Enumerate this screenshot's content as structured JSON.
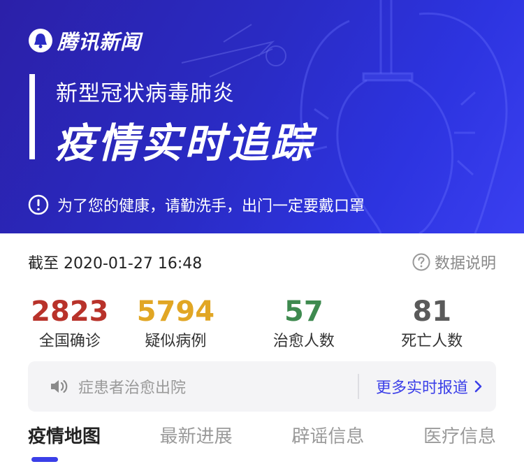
{
  "header": {
    "brand": "腾讯新闻",
    "subtitle": "新型冠状病毒肺炎",
    "title": "疫情实时追踪",
    "tip": "为了您的健康，请勤洗手，出门一定要戴口罩"
  },
  "meta": {
    "as_of": "截至 2020-01-27 16:48",
    "help_label": "数据说明"
  },
  "stats": [
    {
      "value": "2823",
      "label": "全国确诊",
      "color": "#b8322a"
    },
    {
      "value": "5794",
      "label": "疑似病例",
      "color": "#e1a624"
    },
    {
      "value": "57",
      "label": "治愈人数",
      "color": "#3e8a4f"
    },
    {
      "value": "81",
      "label": "死亡人数",
      "color": "#5a5a5a"
    }
  ],
  "ticker": {
    "text": "症患者治愈出院",
    "more_label": "更多实时报道"
  },
  "tabs": [
    {
      "label": "疫情地图",
      "active": true
    },
    {
      "label": "最新进展",
      "active": false
    },
    {
      "label": "辟谣信息",
      "active": false
    },
    {
      "label": "医疗信息",
      "active": false
    }
  ],
  "icons": {
    "brand": "tencent-news-logo-icon",
    "tip": "exclamation-circle-icon",
    "help": "question-circle-icon",
    "speaker": "speaker-icon",
    "chevron": "chevron-right-icon"
  },
  "colors": {
    "hero_bg": "#2a2bc4",
    "accent": "#3b3fe8"
  }
}
